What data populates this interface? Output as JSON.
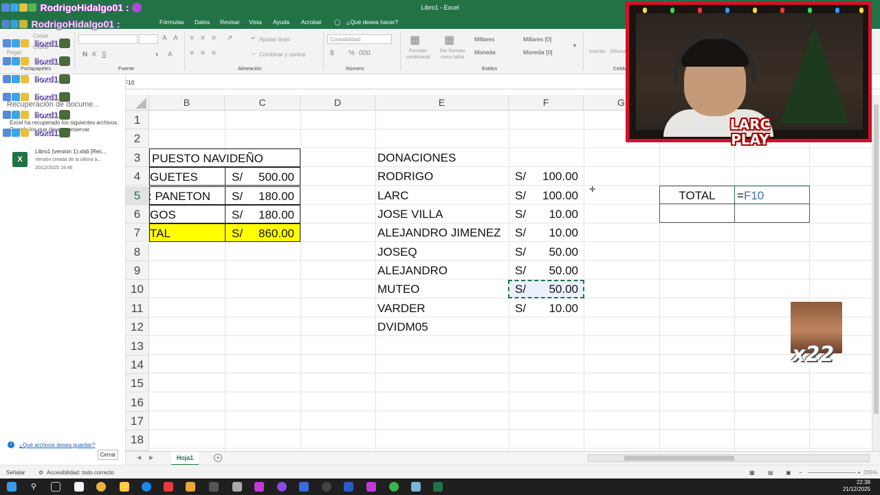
{
  "window": {
    "title": "Libro1  -  Excel"
  },
  "ribbon_tabs": [
    "Fórmulas",
    "Datos",
    "Revisar",
    "Vista",
    "Ayuda",
    "Acrobat",
    "¿Qué desea hacer?"
  ],
  "ribbon": {
    "clipboard": {
      "cut": "Cortar",
      "copy": "Copiar",
      "paste": "Pegar",
      "label": "Portapapeles"
    },
    "font": {
      "label": "Fuente"
    },
    "alignment": {
      "wrap": "Ajustar texto",
      "merge": "Combinar y centrar",
      "label": "Alineación"
    },
    "number": {
      "format": "Contabilidad",
      "label": "Número"
    },
    "styles": {
      "conditional": "Formato condicional",
      "table": "Dar formato como tabla",
      "cells": [
        "Millares",
        "Millares [0]",
        "Moneda",
        "Moneda [0]"
      ],
      "label": "Estilos"
    },
    "cells_group": {
      "insert": "Insertar",
      "delete": "Eliminar",
      "label": "Celdas"
    }
  },
  "formula_bar": {
    "fx": "fx",
    "content": "=F10"
  },
  "recovery_pane": {
    "title": "Recuperación de docume...",
    "message": "Excel ha recuperado los siguientes archivos. Guarde los que desea conservar.",
    "file": {
      "name": "Libro1 (version 1).xlsb  [Rec...",
      "desc": "Versión creada de la última a...",
      "date": "20/12/2025 19:46"
    },
    "question": "¿Qué archivos desea guardar?",
    "close": "Cerrar"
  },
  "chat": {
    "user": "RodrigoHidalgo01 :",
    "user_ghost": "RodrigoHidalgo01 :",
    "emote_text": "lioxd1",
    "emote_rows": 6
  },
  "columns": [
    "B",
    "C",
    "D",
    "E",
    "F",
    "G"
  ],
  "rows": [
    "1",
    "2",
    "3",
    "4",
    "5",
    "6",
    "7",
    "8",
    "9",
    "10",
    "11",
    "12",
    "13",
    "14",
    "15",
    "16",
    "17",
    "18"
  ],
  "budget": {
    "header": "PUESTO NAVIDEÑO",
    "items": [
      {
        "label": "GUETES",
        "cur": "S/",
        "amount": "500.00"
      },
      {
        "label": "PANETON",
        "cur": "S/",
        "amount": "180.00"
      },
      {
        "label": "GOS",
        "cur": "S/",
        "amount": "180.00"
      }
    ],
    "total": {
      "label": "TAL",
      "cur": "S/",
      "amount": "860.00"
    }
  },
  "donations": {
    "header": "DONACIONES",
    "items": [
      {
        "name": "RODRIGO",
        "cur": "S/",
        "amount": "100.00"
      },
      {
        "name": "LARC",
        "cur": "S/",
        "amount": "100.00"
      },
      {
        "name": "JOSE VILLA",
        "cur": "S/",
        "amount": "10.00"
      },
      {
        "name": "ALEJANDRO JIMENEZ",
        "cur": "S/",
        "amount": "10.00"
      },
      {
        "name": "JOSEQ",
        "cur": "S/",
        "amount": "50.00"
      },
      {
        "name": "ALEJANDRO",
        "cur": "S/",
        "amount": "50.00"
      },
      {
        "name": "MUTEO",
        "cur": "S/",
        "amount": "50.00"
      },
      {
        "name": "VARDER",
        "cur": "S/",
        "amount": "10.00"
      },
      {
        "name": "DVIDM05",
        "cur": "",
        "amount": ""
      }
    ]
  },
  "total_box": {
    "label": "TOTAL",
    "formula_eq": "=",
    "formula_ref": "F10"
  },
  "webcam": {
    "logo_line1": "LARC",
    "logo_line2": "PLAY"
  },
  "meme": {
    "count": "x22"
  },
  "sheet_tabs": {
    "active": "Hoja1"
  },
  "statusbar": {
    "mode": "Señalar",
    "accessibility": "Accesibilidad: todo correcto",
    "zoom": "205%"
  },
  "taskbar": {
    "time": "22:38",
    "date": "21/12/2025"
  },
  "colors": {
    "excel_green": "#217346",
    "highlight": "#ffff00",
    "formula_ref": "#3a6fb0"
  }
}
